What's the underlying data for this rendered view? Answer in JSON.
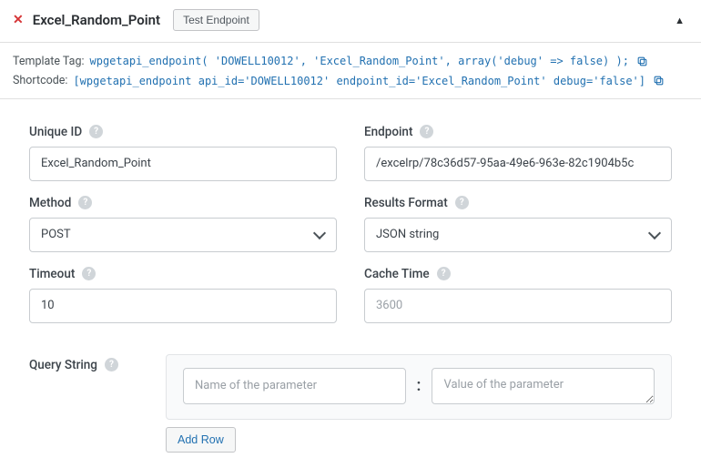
{
  "header": {
    "title": "Excel_Random_Point",
    "test_button": "Test Endpoint"
  },
  "code": {
    "template_label": "Template Tag:",
    "template_code": "wpgetapi_endpoint( 'DOWELL10012', 'Excel_Random_Point', array('debug' => false) );",
    "shortcode_label": "Shortcode:",
    "shortcode_code": "[wpgetapi_endpoint api_id='DOWELL10012' endpoint_id='Excel_Random_Point' debug='false']"
  },
  "form": {
    "unique_id": {
      "label": "Unique ID",
      "value": "Excel_Random_Point"
    },
    "endpoint": {
      "label": "Endpoint",
      "value": "/excelrp/78c36d57-95aa-49e6-963e-82c1904b5c"
    },
    "method": {
      "label": "Method",
      "value": "POST"
    },
    "results": {
      "label": "Results Format",
      "value": "JSON string"
    },
    "timeout": {
      "label": "Timeout",
      "value": "10"
    },
    "cache": {
      "label": "Cache Time",
      "placeholder": "3600"
    }
  },
  "query": {
    "label": "Query String",
    "name_placeholder": "Name of the parameter",
    "value_placeholder": "Value of the parameter",
    "add_row": "Add Row"
  }
}
